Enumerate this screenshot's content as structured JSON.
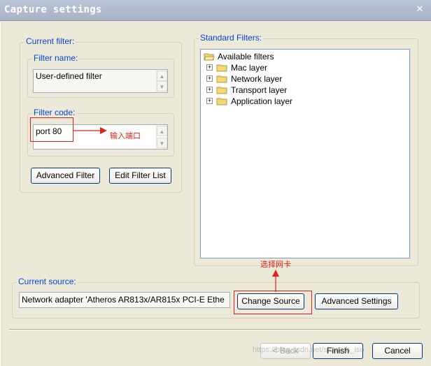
{
  "window": {
    "title": "Capture settings",
    "close_glyph": "✕"
  },
  "current_filter": {
    "legend": "Current filter:",
    "filter_name": {
      "legend": "Filter name:",
      "value": "User-defined filter"
    },
    "filter_code": {
      "legend": "Filter code:",
      "value": "port 80"
    },
    "advanced_filter_label": "Advanced Filter",
    "edit_filter_list_label": "Edit Filter List"
  },
  "standard_filters": {
    "legend": "Standard Filters:",
    "root": "Available filters",
    "items": [
      {
        "label": "Mac layer"
      },
      {
        "label": "Network layer"
      },
      {
        "label": "Transport layer"
      },
      {
        "label": "Application layer"
      }
    ],
    "expander_glyph": "+"
  },
  "annotations": {
    "port_note": "输入端口",
    "nic_note": "选择网卡",
    "color": "#e0201a"
  },
  "current_source": {
    "legend": "Current source:",
    "value": "Network adapter 'Atheros AR813x/AR815x PCI-E Ethe",
    "change_source_label": "Change Source",
    "advanced_settings_label": "Advanced Settings"
  },
  "footer": {
    "back_label": "< Back",
    "finish_label": "Finish",
    "cancel_label": "Cancel"
  },
  "watermark": "https://blog.csdn.net/sicmath_iso",
  "colors": {
    "dialog_bg": "#ece9d8",
    "legend_text": "#0046d5",
    "button_border": "#003c74"
  }
}
